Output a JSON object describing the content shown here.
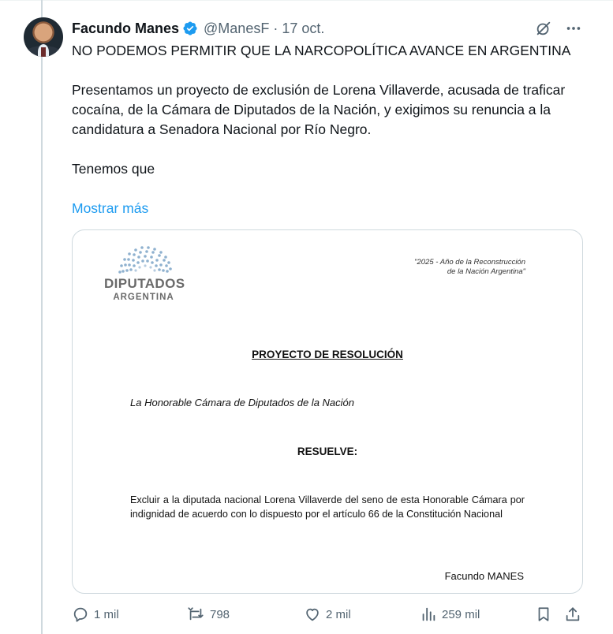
{
  "author": {
    "name": "Facundo Manes",
    "handle": "@ManesF",
    "separator": "·",
    "date": "17 oct."
  },
  "tweet": {
    "lines": [
      "NO PODEMOS PERMITIR QUE LA NARCOPOLÍTICA AVANCE EN ARGENTINA",
      "Presentamos un proyecto de exclusión de Lorena Villaverde, acusada de traficar cocaína, de la Cámara de Diputados de la Nación, y exigimos su renuncia a la candidatura a Senadora Nacional por Río Negro.",
      "Tenemos que"
    ],
    "show_more": "Mostrar más"
  },
  "document": {
    "logo_title": "DIPUTADOS",
    "logo_subtitle": "ARGENTINA",
    "year_line1": "\"2025 - Año de la Reconstrucción",
    "year_line2": "de la Nación Argentina\"",
    "title": "PROYECTO DE RESOLUCIÓN",
    "chamber": "La Honorable Cámara de Diputados de la Nación",
    "resuelve": "RESUELVE:",
    "body": "Excluir a la diputada nacional Lorena Villaverde del seno de esta Honorable Cámara por indignidad de acuerdo con lo dispuesto por el artículo 66 de la Constitución Nacional",
    "signature": "Facundo MANES"
  },
  "actions": {
    "replies": "1 mil",
    "reposts": "798",
    "likes": "2 mil",
    "views": "259 mil"
  },
  "icons": {
    "verified": "verified-badge-icon",
    "grok": "grok-icon",
    "more": "more-icon",
    "reply": "reply-icon",
    "repost": "repost-icon",
    "like": "heart-icon",
    "views": "views-icon",
    "bookmark": "bookmark-icon",
    "share": "share-icon"
  },
  "colors": {
    "accent": "#1d9bf0",
    "muted": "#536471",
    "text": "#0f1419",
    "border": "#cfd9de"
  }
}
